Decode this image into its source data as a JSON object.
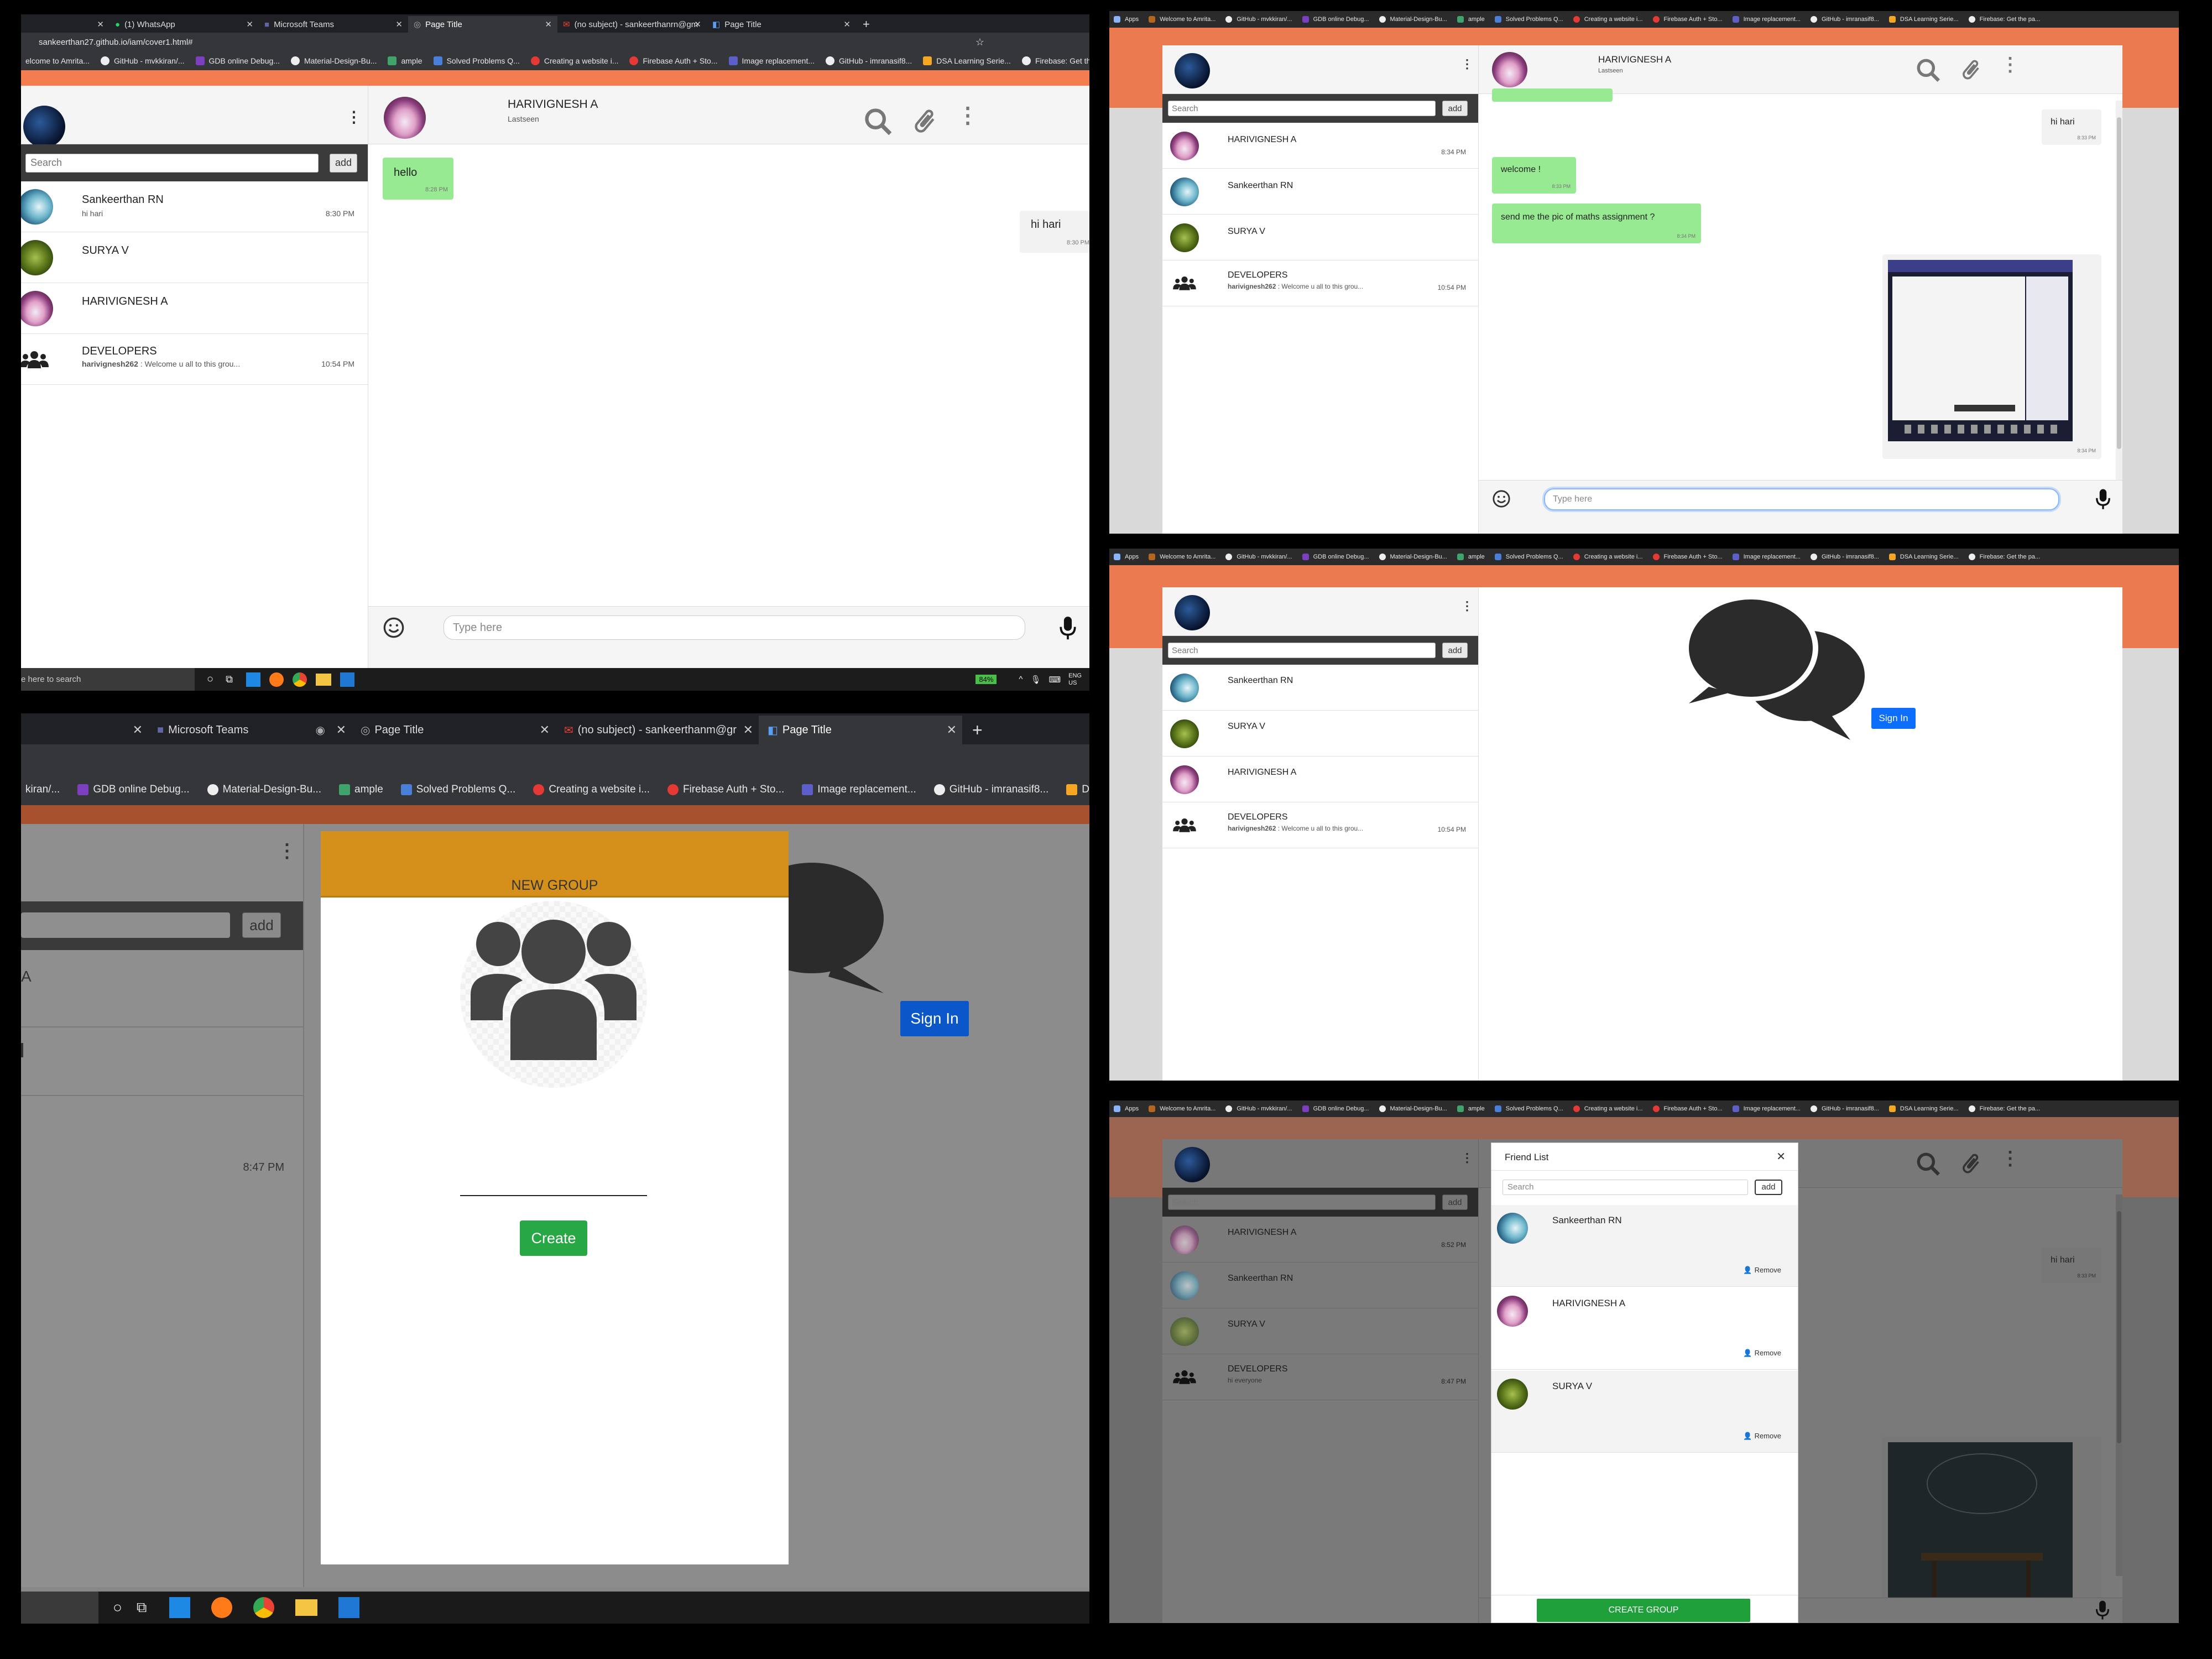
{
  "browser": {
    "tabs": [
      "(1) WhatsApp",
      "Microsoft Teams",
      "Page Title",
      "(no subject) - sankeerthanrn@gm",
      "Page Title"
    ],
    "tabs_zoomed": [
      "Microsoft Teams",
      "Page Title",
      "(no subject) - sankeerthanm@gr",
      "Page Title"
    ],
    "url": "sankeerthan27.github.io/iam/cover1.html#",
    "new_tab": "+",
    "apps": "Apps",
    "bookmarks": [
      "elcome to Amrita...",
      "GitHub - mvkkiran/...",
      "GDB online Debug...",
      "Material-Design-Bu...",
      "ample",
      "Solved Problems Q...",
      "Creating a website i...",
      "Firebase Auth + Sto...",
      "Image replacement...",
      "GitHub - imranasif8...",
      "DSA Learning Serie...",
      "Firebase: Get the..."
    ],
    "bookmarks_small": [
      "Welcome to Amrita...",
      "GitHub - mvkkiran/...",
      "GDB online Debug...",
      "Material-Design-Bu...",
      "ample",
      "Solved Problems Q...",
      "Creating a website i...",
      "Firebase Auth + Sto...",
      "Image replacement...",
      "GitHub - imranasif8...",
      "DSA Learning Serie...",
      "Firebase: Get the pa..."
    ],
    "bookmarks_zoomed": [
      "kiran/...",
      "GDB online Debug...",
      "Material-Design-Bu...",
      "ample",
      "Solved Problems Q...",
      "Creating a website i...",
      "Firebase Auth + Sto...",
      "Image replacement...",
      "GitHub - imranasif8...",
      "DSA"
    ]
  },
  "app": {
    "search_placeholder": "Search",
    "add_label": "add",
    "type_placeholder": "Type here",
    "chats_a": [
      {
        "name": "Sankeerthan RN",
        "msg": "hi hari",
        "time": "8:30 PM"
      },
      {
        "name": "SURYA V",
        "msg": "",
        "time": ""
      },
      {
        "name": "HARIVIGNESH A",
        "msg": "",
        "time": ""
      },
      {
        "name": "DEVELOPERS",
        "sender": "harivignesh262",
        "msg": " : Welcome u all to this grou...",
        "time": "10:54 PM"
      }
    ],
    "chats_b": [
      {
        "name": "HARIVIGNESH A",
        "msg": "",
        "time": "8:34 PM"
      },
      {
        "name": "Sankeerthan RN",
        "msg": "",
        "time": ""
      },
      {
        "name": "SURYA V",
        "msg": "",
        "time": ""
      },
      {
        "name": "DEVELOPERS",
        "sender": "harivignesh262",
        "msg": " : Welcome u all to this grou...",
        "time": "10:54 PM"
      }
    ],
    "chats_c": [
      {
        "name": "Sankeerthan RN",
        "msg": "",
        "time": ""
      },
      {
        "name": "SURYA V",
        "msg": "",
        "time": ""
      },
      {
        "name": "HARIVIGNESH A",
        "msg": "",
        "time": ""
      },
      {
        "name": "DEVELOPERS",
        "sender": "harivignesh262",
        "msg": " : Welcome u all to this grou...",
        "time": "10:54 PM"
      }
    ],
    "chats_e": [
      {
        "name": "HARIVIGNESH A",
        "msg": "",
        "time": "8:52 PM"
      },
      {
        "name": "Sankeerthan RN",
        "msg": "",
        "time": ""
      },
      {
        "name": "SURYA V",
        "msg": "",
        "time": ""
      },
      {
        "name": "DEVELOPERS",
        "msg": "hi everyone",
        "time": "8:47 PM"
      }
    ],
    "header_name": "HARIVIGNESH A",
    "header_status": "Lastseen",
    "messages_a": [
      {
        "text": "hello",
        "time": "8:28 PM",
        "dir": "in"
      },
      {
        "text": "hi hari",
        "time": "8:30 PM",
        "dir": "out"
      }
    ],
    "messages_b": [
      {
        "text": "hi hari",
        "time": "8:33 PM",
        "dir": "out"
      },
      {
        "text": "welcome !",
        "time": "8:33 PM",
        "dir": "in"
      },
      {
        "text": "send me the pic of maths assignment ?",
        "time": "8:34 PM",
        "dir": "in"
      },
      {
        "text": "",
        "time": "8:34 PM",
        "dir": "out"
      }
    ],
    "messages_e": [
      {
        "text": "hi hari",
        "time": "8:33 PM",
        "dir": "out"
      }
    ],
    "sign_in": "Sign In",
    "new_group_title": "NEW GROUP",
    "create_label": "Create",
    "partial_time": "8:47 PM",
    "partial_letter": "A",
    "friend_list_title": "Friend List",
    "friends": [
      {
        "name": "Sankeerthan RN",
        "action": "Remove"
      },
      {
        "name": "HARIVIGNESH A",
        "action": "Remove"
      },
      {
        "name": "SURYA V",
        "action": "Remove"
      }
    ],
    "create_group": "CREATE GROUP"
  },
  "taskbar": {
    "search_text": "e here to search",
    "battery": "84%",
    "lang": "ENG",
    "region": "US"
  },
  "colors": {
    "accent_orange": "#f37d4f",
    "bubble_green": "#97ea92",
    "modal_header": "#d4901a",
    "create_green": "#28a745",
    "signin_blue": "#0d6efd"
  }
}
